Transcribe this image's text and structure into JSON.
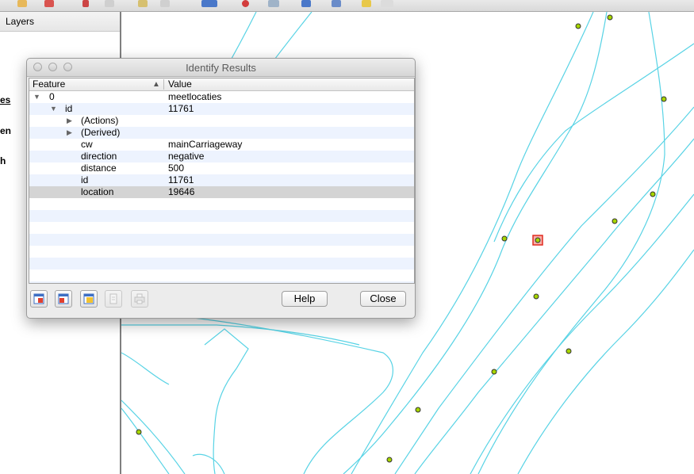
{
  "toolbar": {
    "icons": [
      "digitize-icon",
      "delete-icon",
      "pan-icon",
      "node-icon",
      "save-edits-icon",
      "snap-icon",
      "record-icon",
      "stop-icon",
      "view-icon",
      "zoom-in-icon",
      "zoom-out-icon",
      "pencil-icon",
      "move-icon"
    ]
  },
  "layers_panel": {
    "title": "Layers",
    "visible_fragments": [
      "es",
      "en",
      "h"
    ]
  },
  "dialog": {
    "title": "Identify Results",
    "columns": {
      "feature": "Feature",
      "value": "Value"
    },
    "rows": [
      {
        "feature": "0",
        "value": "meetlocaties"
      },
      {
        "feature": "id",
        "value": "11761"
      },
      {
        "feature": "(Actions)",
        "value": ""
      },
      {
        "feature": "(Derived)",
        "value": ""
      },
      {
        "feature": "cw",
        "value": "mainCarriageway"
      },
      {
        "feature": "direction",
        "value": "negative"
      },
      {
        "feature": "distance",
        "value": "500"
      },
      {
        "feature": "id",
        "value": "11761"
      },
      {
        "feature": "location",
        "value": "19646"
      }
    ],
    "selected_row": "location",
    "buttons": {
      "help": "Help",
      "close": "Close"
    },
    "icon_buttons": [
      "expand-tree-icon",
      "collapse-tree-icon",
      "expand-new-results-icon",
      "copy-icon",
      "print-icon"
    ]
  },
  "map": {
    "line_color": "#58d3e5",
    "point_fill": "#a6d500",
    "selected_point_border": "#e02b20"
  }
}
